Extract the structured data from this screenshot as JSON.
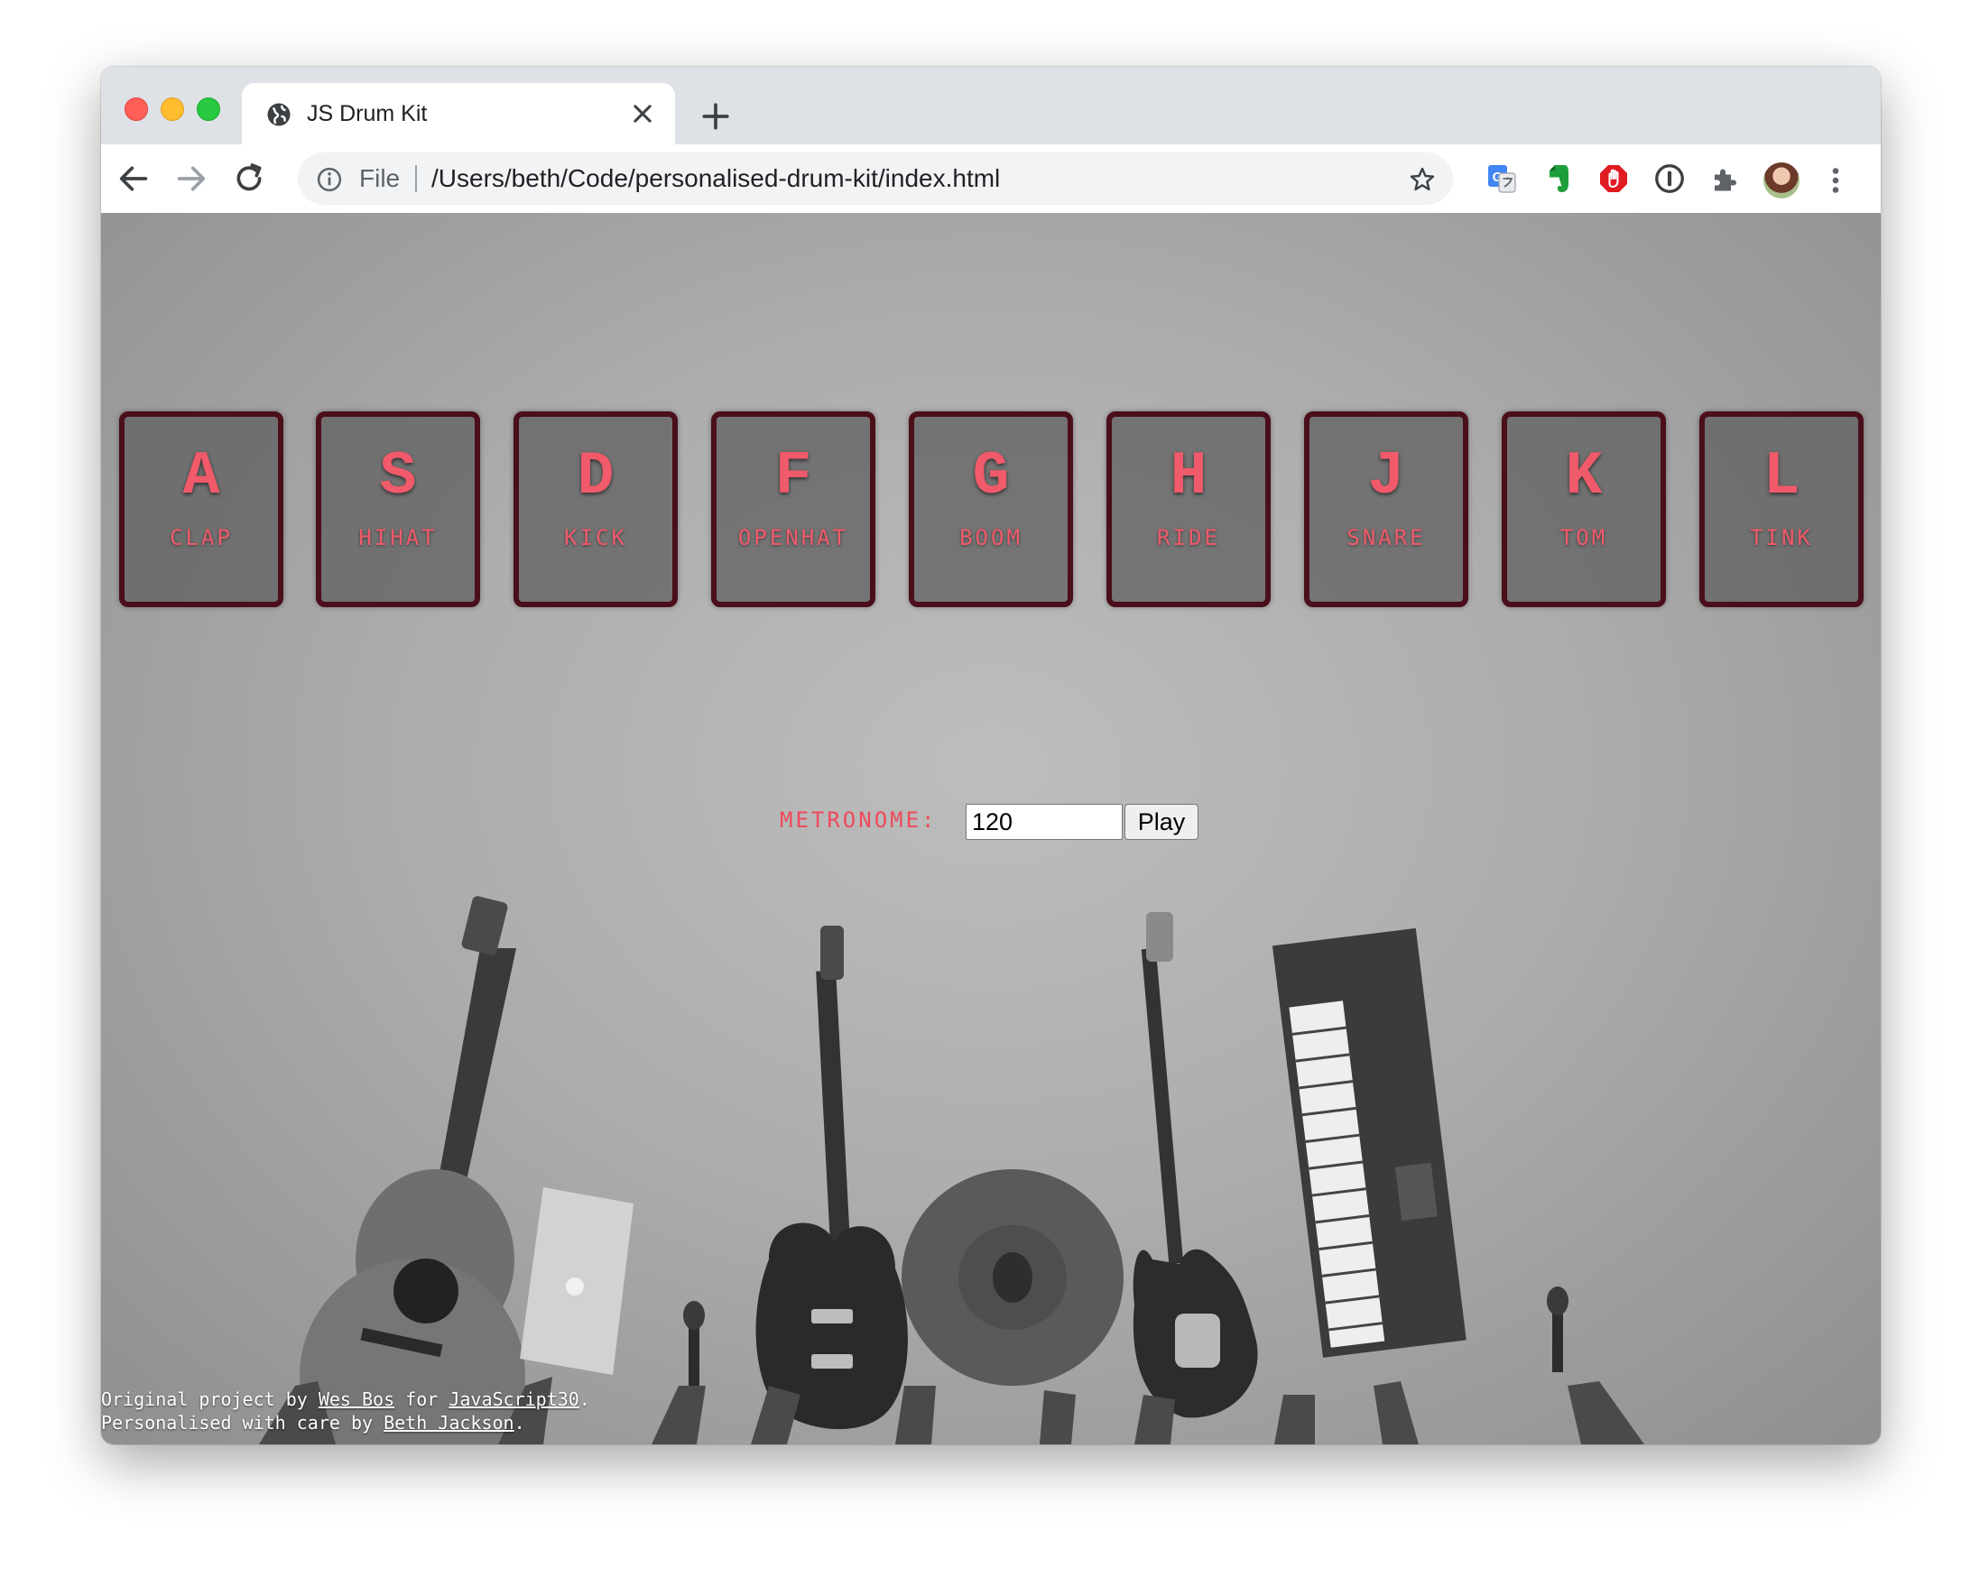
{
  "browser": {
    "tab_title": "JS Drum Kit",
    "scheme_label": "File",
    "url": "/Users/beth/Code/personalised-drum-kit/index.html"
  },
  "keys": [
    {
      "letter": "A",
      "sound": "CLAP"
    },
    {
      "letter": "S",
      "sound": "HIHAT"
    },
    {
      "letter": "D",
      "sound": "KICK"
    },
    {
      "letter": "F",
      "sound": "OPENHAT"
    },
    {
      "letter": "G",
      "sound": "BOOM"
    },
    {
      "letter": "H",
      "sound": "RIDE"
    },
    {
      "letter": "J",
      "sound": "SNARE"
    },
    {
      "letter": "K",
      "sound": "TOM"
    },
    {
      "letter": "L",
      "sound": "TINK"
    }
  ],
  "metronome": {
    "label": "METRONOME:",
    "bpm_value": "120",
    "play_label": "Play"
  },
  "credits": {
    "line1_prefix": "Original project by",
    "line1_author": "Wes Bos",
    "line1_mid": "for",
    "line1_project": "JavaScript30",
    "line1_end": ".",
    "line2_prefix": "Personalised with care by",
    "line2_author": "Beth Jackson",
    "line2_end": "."
  },
  "colors": {
    "accent": "#ef4a5c",
    "key_border": "#4a0f1a"
  }
}
